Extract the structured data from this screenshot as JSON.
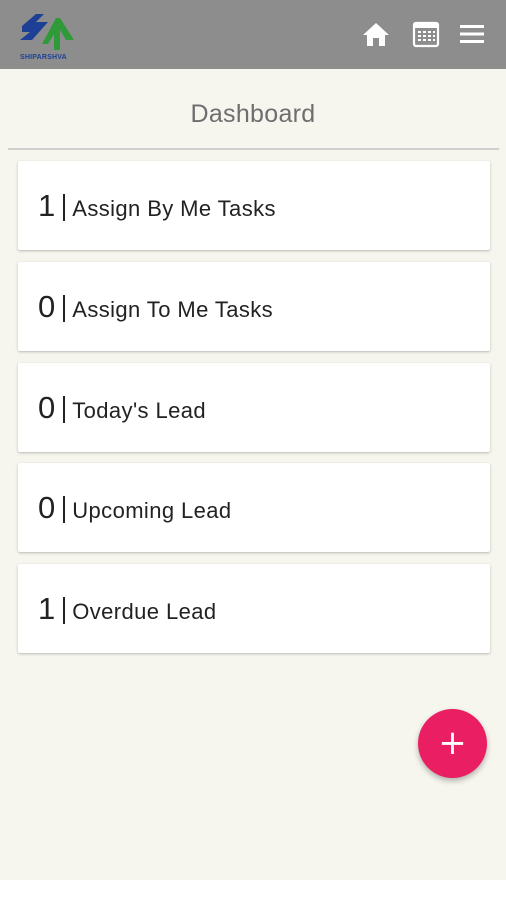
{
  "app": {
    "logo_text": "SHIPARSHVA",
    "brand_colors": {
      "primary": "#1d3f95",
      "secondary": "#2e9a3a"
    },
    "appbar_color": "#8d8d8d"
  },
  "header": {
    "icons": [
      "home-icon",
      "calendar-icon",
      "menu-icon"
    ]
  },
  "page": {
    "title": "Dashboard"
  },
  "cards": [
    {
      "count": "1",
      "label": "Assign By Me Tasks"
    },
    {
      "count": "0",
      "label": "Assign To Me Tasks"
    },
    {
      "count": "0",
      "label": "Today's Lead"
    },
    {
      "count": "0",
      "label": "Upcoming Lead"
    },
    {
      "count": "1",
      "label": "Overdue Lead"
    }
  ],
  "fab": {
    "icon": "plus-icon",
    "glyph": "+",
    "color": "#e91e63"
  }
}
